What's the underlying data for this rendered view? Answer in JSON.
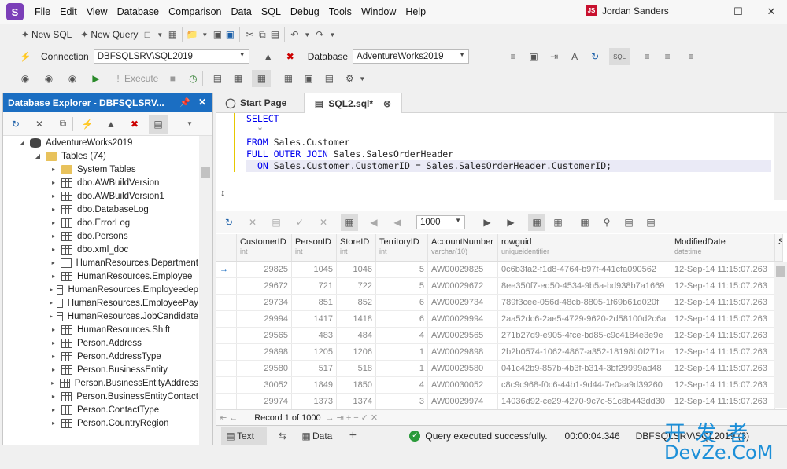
{
  "menu": {
    "items": [
      "File",
      "Edit",
      "View",
      "Database",
      "Comparison",
      "Data",
      "SQL",
      "Debug",
      "Tools",
      "Window",
      "Help"
    ],
    "user_initials": "JS",
    "user_name": "Jordan Sanders"
  },
  "toolbar1": {
    "new_sql": "New SQL",
    "new_query": "New Query"
  },
  "toolbar2": {
    "connection_label": "Connection",
    "connection_value": "DBFSQLSRV\\SQL2019",
    "database_label": "Database",
    "database_value": "AdventureWorks2019"
  },
  "toolbar3": {
    "execute": "Execute"
  },
  "explorer": {
    "title": "Database Explorer - DBFSQLSRV...",
    "database": "AdventureWorks2019",
    "tables_folder": "Tables (74)",
    "items": [
      "System Tables",
      "dbo.AWBuildVersion",
      "dbo.AWBuildVersion1",
      "dbo.DatabaseLog",
      "dbo.ErrorLog",
      "dbo.Persons",
      "dbo.xml_doc",
      "HumanResources.Department",
      "HumanResources.Employee",
      "HumanResources.Employeedep",
      "HumanResources.EmployeePay",
      "HumanResources.JobCandidate",
      "HumanResources.Shift",
      "Person.Address",
      "Person.AddressType",
      "Person.BusinessEntity",
      "Person.BusinessEntityAddress",
      "Person.BusinessEntityContact",
      "Person.ContactType",
      "Person.CountryRegion"
    ]
  },
  "tabs": {
    "start": "Start Page",
    "sql": "SQL2.sql*"
  },
  "sql": {
    "l1": "SELECT",
    "l2": "*",
    "l3a": "FROM",
    "l3b": " Sales.Customer",
    "l4a": "FULL OUTER JOIN",
    "l4b": " Sales.SalesOrderHeader",
    "l5a": "ON",
    "l5b": " Sales.Customer.CustomerID = Sales.SalesOrderHeader.CustomerID;"
  },
  "grid": {
    "page_size": "1000",
    "columns": [
      {
        "name": "CustomerID",
        "type": "int"
      },
      {
        "name": "PersonID",
        "type": "int"
      },
      {
        "name": "StoreID",
        "type": "int"
      },
      {
        "name": "TerritoryID",
        "type": "int"
      },
      {
        "name": "AccountNumber",
        "type": "varchar(10)"
      },
      {
        "name": "rowguid",
        "type": "uniqueidentifier"
      },
      {
        "name": "ModifiedDate",
        "type": "datetime"
      },
      {
        "name": "Sa",
        "type": ""
      }
    ],
    "rows": [
      [
        "29825",
        "1045",
        "1046",
        "5",
        "AW00029825",
        "0c6b3fa2-f1d8-4764-b97f-441cfa090562",
        "12-Sep-14 11:15:07.263"
      ],
      [
        "29672",
        "721",
        "722",
        "5",
        "AW00029672",
        "8ee350f7-ed50-4534-9b5a-bd938b7a1669",
        "12-Sep-14 11:15:07.263"
      ],
      [
        "29734",
        "851",
        "852",
        "6",
        "AW00029734",
        "789f3cee-056d-48cb-8805-1f69b61d020f",
        "12-Sep-14 11:15:07.263"
      ],
      [
        "29994",
        "1417",
        "1418",
        "6",
        "AW00029994",
        "2aa52dc6-2ae5-4729-9620-2d58100d2c6a",
        "12-Sep-14 11:15:07.263"
      ],
      [
        "29565",
        "483",
        "484",
        "4",
        "AW00029565",
        "271b27d9-e905-4fce-bd85-c9c4184e3e9e",
        "12-Sep-14 11:15:07.263"
      ],
      [
        "29898",
        "1205",
        "1206",
        "1",
        "AW00029898",
        "2b2b0574-1062-4867-a352-18198b0f271a",
        "12-Sep-14 11:15:07.263"
      ],
      [
        "29580",
        "517",
        "518",
        "1",
        "AW00029580",
        "041c42b9-857b-4b3f-b314-3bf29999ad48",
        "12-Sep-14 11:15:07.263"
      ],
      [
        "30052",
        "1849",
        "1850",
        "4",
        "AW00030052",
        "c8c9c968-f0c6-44b1-9d44-7e0aa9d39260",
        "12-Sep-14 11:15:07.263"
      ],
      [
        "29974",
        "1373",
        "1374",
        "3",
        "AW00029974",
        "14036d92-ce29-4270-9c7c-51c8b443dd30",
        "12-Sep-14 11:15:07.263"
      ]
    ],
    "record_text": "Record 1 of 1000"
  },
  "status": {
    "text_tab": "Text",
    "data_tab": "Data",
    "message": "Query executed successfully.",
    "elapsed": "00:00:04.346",
    "server": "DBFSQLSRV\\SQL2019 (3)"
  },
  "watermark": {
    "cn": "开 发 者",
    "en": "DevZe.CoM"
  }
}
